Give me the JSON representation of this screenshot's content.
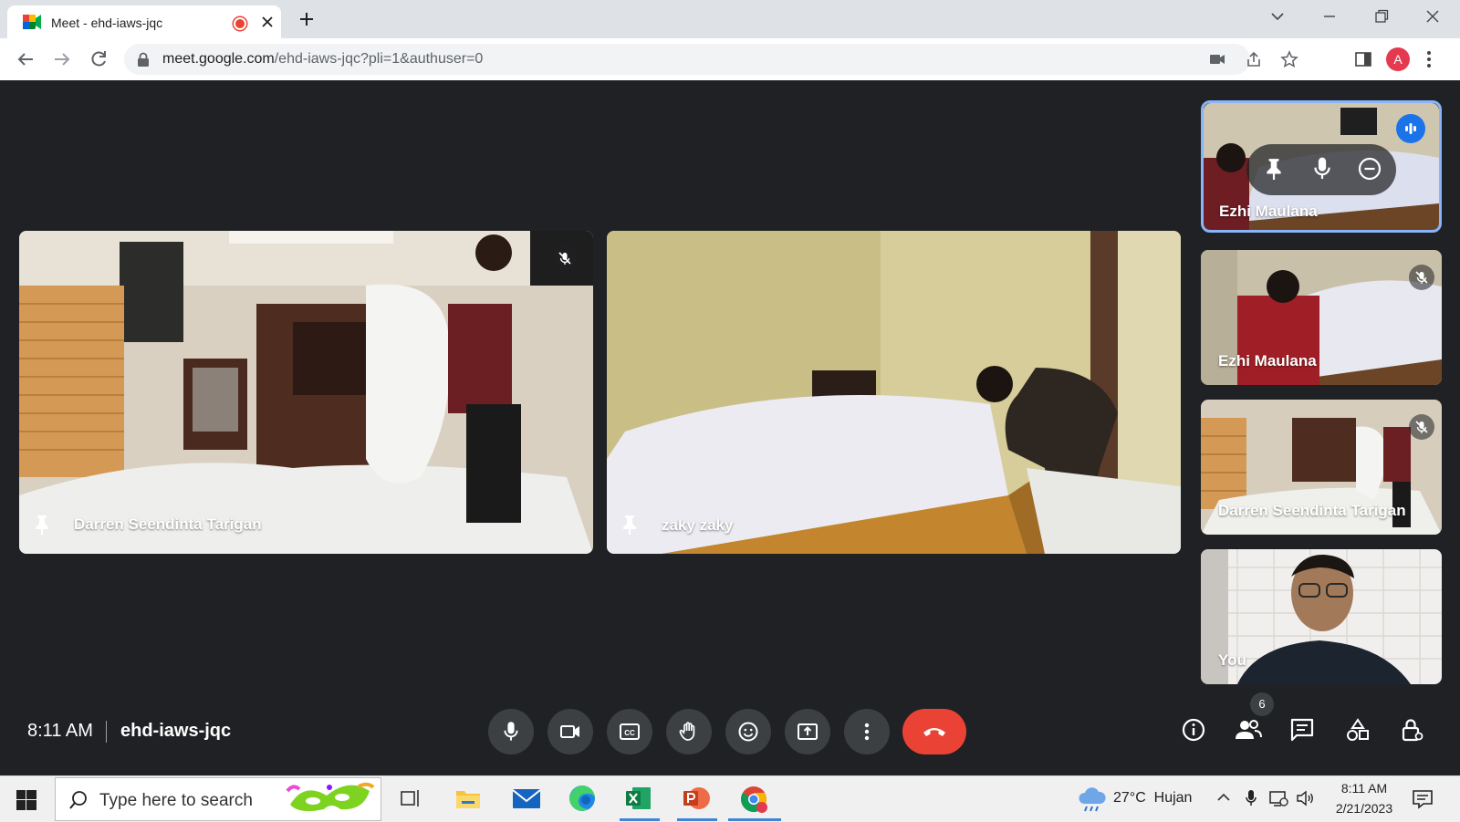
{
  "browser": {
    "tab_title": "Meet - ehd-iaws-jqc",
    "url_domain": "meet.google.com",
    "url_rest": "/ehd-iaws-jqc?pli=1&authuser=0",
    "profile_initial": "A"
  },
  "meet": {
    "tiles": [
      {
        "name": "Darren Seendinta Tarigan"
      },
      {
        "name": "zaky zaky"
      }
    ],
    "sidebar": [
      {
        "name": "Ezhi Maulana"
      },
      {
        "name": "Ezhi Maulana"
      },
      {
        "name": "Darren Seendinta Tarigan"
      },
      {
        "name": "You"
      }
    ],
    "time": "8:11 AM",
    "meeting_code": "ehd-iaws-jqc",
    "participant_count": "6"
  },
  "taskbar": {
    "search_placeholder": "Type here to search",
    "weather_temp": "27°C",
    "weather_desc": "Hujan",
    "clock_time": "8:11 AM",
    "clock_date": "2/21/2023"
  },
  "colors": {
    "meet_bg": "#202124",
    "end_call": "#ea4335",
    "speaking": "#1a73e8"
  }
}
